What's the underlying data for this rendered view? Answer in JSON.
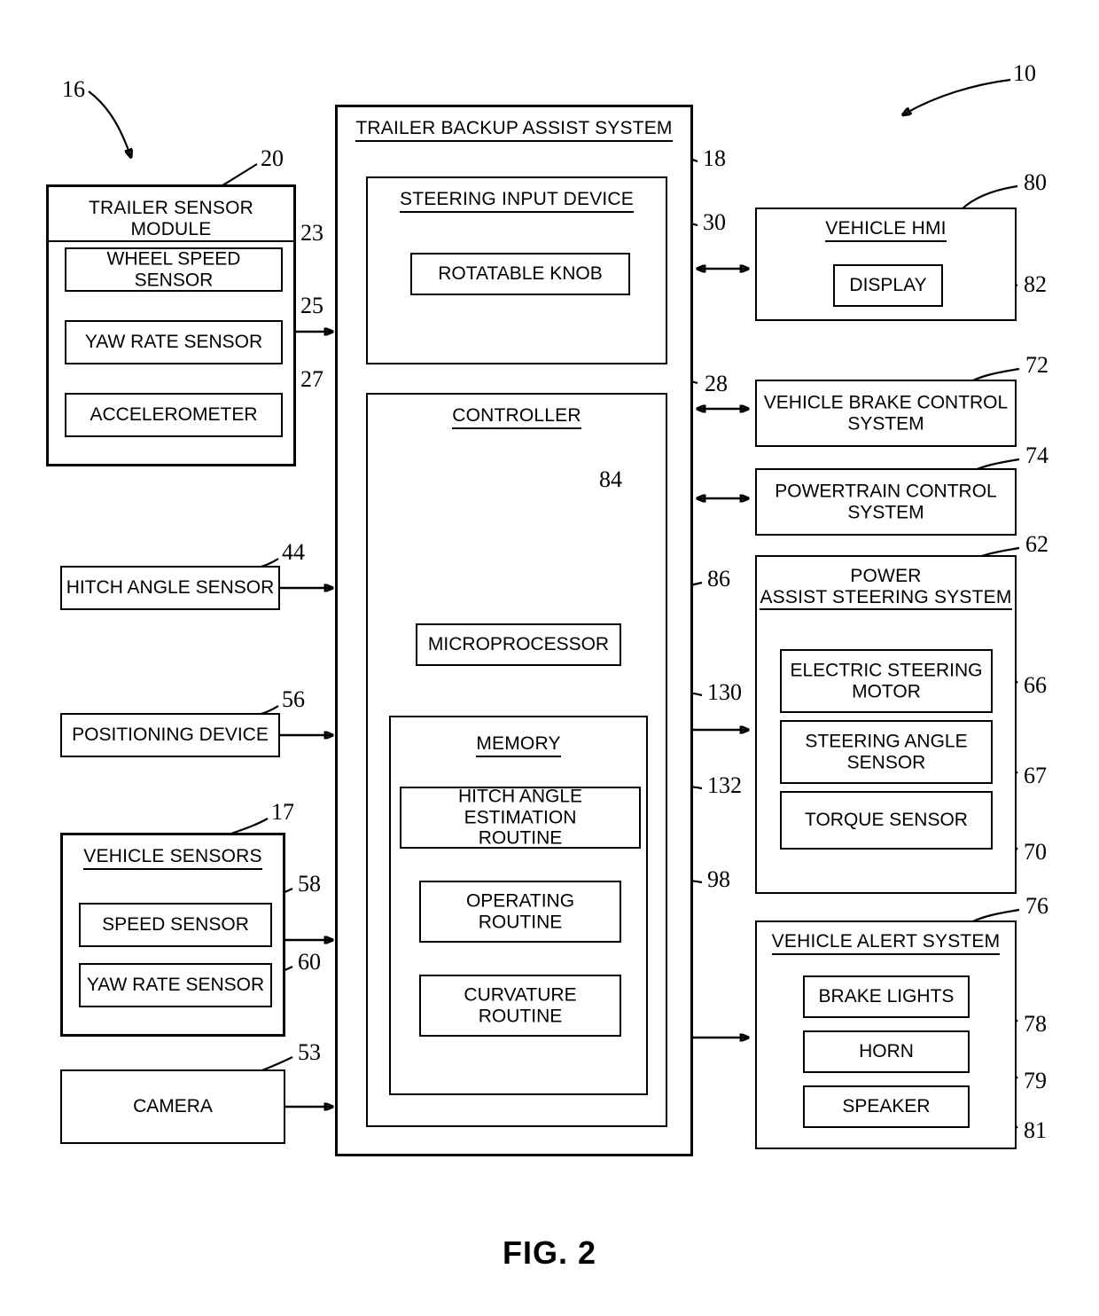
{
  "figure": {
    "caption": "FIG. 2",
    "overall_ref": "10"
  },
  "trailer_sensor_module": {
    "title": "TRAILER SENSOR MODULE",
    "ref": "20",
    "group_ref": "16",
    "items": [
      {
        "label": "WHEEL SPEED SENSOR",
        "ref": "23"
      },
      {
        "label": "YAW RATE SENSOR",
        "ref": "25"
      },
      {
        "label": "ACCELEROMETER",
        "ref": "27"
      }
    ]
  },
  "hitch_angle_sensor": {
    "label": "HITCH ANGLE SENSOR",
    "ref": "44"
  },
  "positioning_device": {
    "label": "POSITIONING DEVICE",
    "ref": "56"
  },
  "vehicle_sensors": {
    "title": "VEHICLE SENSORS",
    "ref": "17",
    "items": [
      {
        "label": "SPEED SENSOR",
        "ref": "58"
      },
      {
        "label": "YAW RATE SENSOR",
        "ref": "60"
      }
    ]
  },
  "camera": {
    "label": "CAMERA",
    "ref": "53"
  },
  "trailer_backup_assist_system": {
    "title": "TRAILER BACKUP ASSIST SYSTEM",
    "steering_input_device": {
      "title": "STEERING INPUT DEVICE",
      "ref": "18",
      "knob": {
        "label": "ROTATABLE KNOB",
        "ref": "30"
      }
    },
    "controller": {
      "title": "CONTROLLER",
      "ref": "28",
      "microprocessor": {
        "label": "MICROPROCESSOR",
        "ref": "84"
      },
      "memory": {
        "title": "MEMORY",
        "ref": "86",
        "routines": [
          {
            "label": "HITCH ANGLE ESTIMATION\nROUTINE",
            "ref": "130"
          },
          {
            "label": "OPERATING\nROUTINE",
            "ref": "132"
          },
          {
            "label": "CURVATURE\nROUTINE",
            "ref": "98"
          }
        ]
      }
    }
  },
  "vehicle_hmi": {
    "title": "VEHICLE HMI",
    "ref": "80",
    "display": {
      "label": "DISPLAY",
      "ref": "82"
    }
  },
  "vehicle_brake_control_system": {
    "label": "VEHICLE BRAKE CONTROL\nSYSTEM",
    "ref": "72"
  },
  "powertrain_control_system": {
    "label": "POWERTRAIN CONTROL\nSYSTEM",
    "ref": "74"
  },
  "power_assist_steering_system": {
    "title": "POWER\nASSIST STEERING SYSTEM",
    "ref": "62",
    "items": [
      {
        "label": "ELECTRIC STEERING\nMOTOR",
        "ref": "66"
      },
      {
        "label": "STEERING ANGLE\nSENSOR",
        "ref": "67"
      },
      {
        "label": "TORQUE SENSOR",
        "ref": "70"
      }
    ]
  },
  "vehicle_alert_system": {
    "title": "VEHICLE ALERT SYSTEM",
    "ref": "76",
    "items": [
      {
        "label": "BRAKE LIGHTS",
        "ref": "78"
      },
      {
        "label": "HORN",
        "ref": "79"
      },
      {
        "label": "SPEAKER",
        "ref": "81"
      }
    ]
  }
}
